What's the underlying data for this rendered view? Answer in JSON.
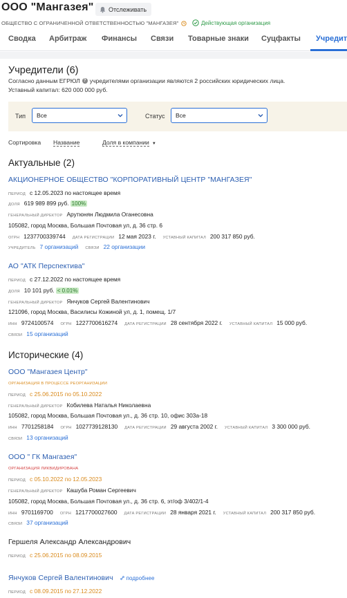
{
  "header": {
    "company_name": "ООО \"Мангазея\"",
    "track_button": "Отслеживать",
    "subtitle": "ОБЩЕСТВО С ОГРАНИЧЕННОЙ ОТВЕТСТВЕННОСТЬЮ \"МАНГАЗЕЯ\"",
    "status": "Действующая организация",
    "status_color": "#2e9a48"
  },
  "tabs": [
    "Сводка",
    "Арбитраж",
    "Финансы",
    "Связи",
    "Товарные знаки",
    "Суцфакты",
    "Учредители"
  ],
  "active_tab": "Учредители",
  "founders": {
    "title": "Учредители (6)",
    "note_before": "Согласно данным ЕГРЮЛ",
    "note_after": "учредителями организации являются 2 российских юридических лица.",
    "capital": "Уставный капитал: 620 000 000 руб."
  },
  "filters": {
    "type_label": "Тип",
    "type_value": "Все",
    "status_label": "Статус",
    "status_value": "Все"
  },
  "sort": {
    "label": "Сортировка",
    "by_name": "Название",
    "by_share": "Доля в компании",
    "arrow": "▼"
  },
  "labels": {
    "period": "период",
    "share": "доля",
    "director": "генеральный директор",
    "ogrn": "огрн",
    "inn": "инн",
    "reg_date": "дата регистрации",
    "capital": "уставный капитал",
    "founder": "учредитель",
    "links": "связи"
  },
  "current": {
    "title": "Актуальные (2)",
    "items": [
      {
        "name": "АКЦИОНЕРНОЕ ОБЩЕСТВО \"КОРПОРАТИВНЫЙ ЦЕНТР \"МАНГАЗЕЯ\"",
        "period": "с 12.05.2023 по настоящее время",
        "share": "619 989 899 руб.",
        "share_pct": "100%",
        "director": "Арутюнян Людмила Оганесовна",
        "address": "105082, город Москва, Большая Почтовая ул, д. 36 стр. 6",
        "ogrn": "1237700339744",
        "reg_date": "12 мая 2023 г.",
        "capital": "200 317 850 руб.",
        "founder": "7 организаций",
        "links": "22 организации"
      },
      {
        "name": "АО \"АТК Перспектива\"",
        "period": "с 27.12.2022 по настоящее время",
        "share": "10 101 руб.",
        "share_pct": "< 0.01%",
        "director": "Янчуков Сергей Валентинович",
        "address": "121096, город Москва, Василисы Кожиной ул, д. 1, помещ. 1/7",
        "inn": "9724100574",
        "ogrn": "1227700616274",
        "reg_date": "28 сентября 2022 г.",
        "capital": "15 000 руб.",
        "links": "15 организаций"
      }
    ]
  },
  "historical": {
    "title": "Исторические (4)",
    "items": [
      {
        "name": "ООО \"Мангазея Центр\"",
        "status": "организация в процессе реорганизации",
        "period": "с 25.06.2015 по 05.10.2022",
        "director": "Кобилева Наталья Николаевна",
        "address": "105082, город Москва, Большая Почтовая ул., д. 36 стр. 10, офис 303а-18",
        "inn": "7701258184",
        "ogrn": "1027739128130",
        "reg_date": "29 августа 2002 г.",
        "capital": "3 300 000 руб.",
        "links": "13 организаций"
      },
      {
        "name": "ООО \" ГК Мангазея\"",
        "status": "организация ликвидирована",
        "period": "с 05.10.2022 по 12.05.2023",
        "director": "Кашуба Роман Сергеевич",
        "address": "105082, город Москва, Большая Почтовая ул., д. 36 стр. 6, эт/оф 3/402/1-4",
        "inn": "9701169700",
        "ogrn": "1217700027600",
        "reg_date": "28 января 2021 г.",
        "capital": "200 317 850 руб.",
        "links": "37 организаций"
      },
      {
        "name": "Гершеля Александр Александрович",
        "period": "с 25.06.2015 по 08.09.2015"
      },
      {
        "name": "Янчуков Сергей Валентинович",
        "more": "подробнее",
        "period": "с 08.09.2015 по 27.12.2022"
      }
    ]
  }
}
